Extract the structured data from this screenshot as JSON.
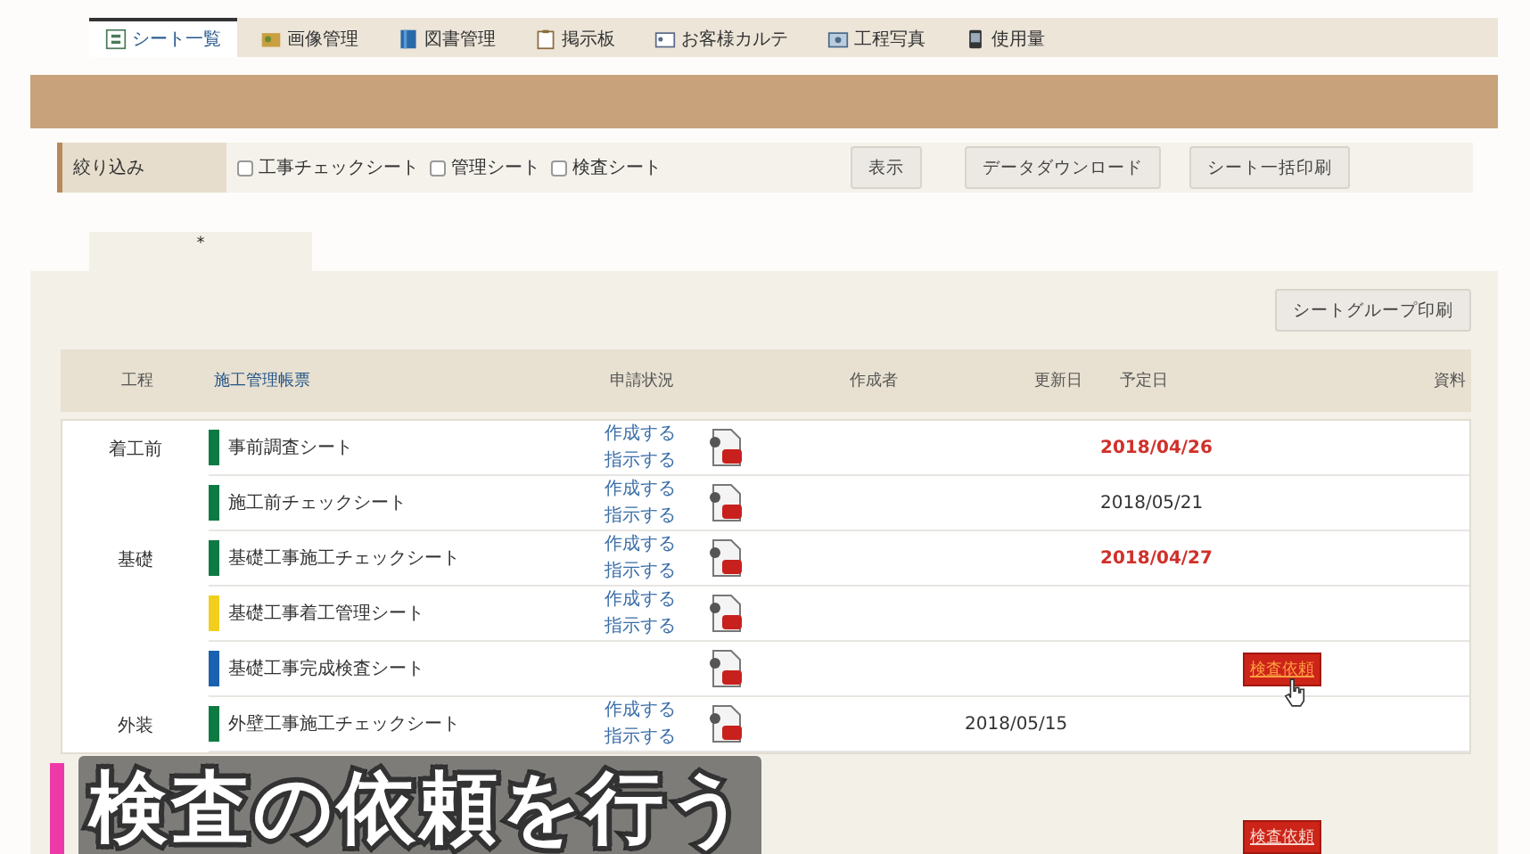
{
  "nav_tabs": [
    {
      "label": "シート一覧",
      "selected": true
    },
    {
      "label": "画像管理",
      "selected": false
    },
    {
      "label": "図書管理",
      "selected": false
    },
    {
      "label": "掲示板",
      "selected": false
    },
    {
      "label": "お客様カルテ",
      "selected": false
    },
    {
      "label": "工程写真",
      "selected": false
    },
    {
      "label": "使用量",
      "selected": false
    }
  ],
  "filter": {
    "label": "絞り込み",
    "options": [
      {
        "label": "工事チェックシート",
        "checked": false
      },
      {
        "label": "管理シート",
        "checked": false
      },
      {
        "label": "検査シート",
        "checked": false
      }
    ],
    "buttons": [
      "表示",
      "データダウンロード",
      "シート一括印刷"
    ]
  },
  "group_tab": {
    "label": "*"
  },
  "group_print_button": "シートグループ印刷",
  "table": {
    "columns": [
      "工程",
      "施工管理帳票",
      "申請状況",
      "作成者",
      "更新日",
      "予定日",
      "資料"
    ],
    "rows": [
      {
        "process": "着工前",
        "name": "事前調査シート",
        "color": "#0e7a43",
        "links": [
          "作成する",
          "指示する"
        ],
        "updated": "",
        "due": "2018/04/26",
        "overdue": true,
        "request": ""
      },
      {
        "process": "",
        "name": "施工前チェックシート",
        "color": "#0e7a43",
        "links": [
          "作成する",
          "指示する"
        ],
        "updated": "",
        "due": "2018/05/21",
        "overdue": false,
        "request": ""
      },
      {
        "process": "基礎",
        "name": "基礎工事施工チェックシート",
        "color": "#0e7a43",
        "links": [
          "作成する",
          "指示する"
        ],
        "updated": "",
        "due": "2018/04/27",
        "overdue": true,
        "request": ""
      },
      {
        "process": "",
        "name": "基礎工事着工管理シート",
        "color": "#f2cf1d",
        "links": [
          "作成する",
          "指示する"
        ],
        "updated": "",
        "due": "",
        "request": ""
      },
      {
        "process": "",
        "name": "基礎工事完成検査シート",
        "color": "#1a62b0",
        "links": [],
        "updated": "",
        "due": "",
        "request": "検査依頼",
        "hover": true
      },
      {
        "process": "外装",
        "name": "外壁工事施工チェックシート",
        "color": "#0e7a43",
        "links": [
          "作成する",
          "指示する"
        ],
        "updated": "2018/05/15",
        "due": "",
        "request": ""
      }
    ]
  },
  "caption": "検査の依頼を行う",
  "hidden_row_request": "検査依頼"
}
